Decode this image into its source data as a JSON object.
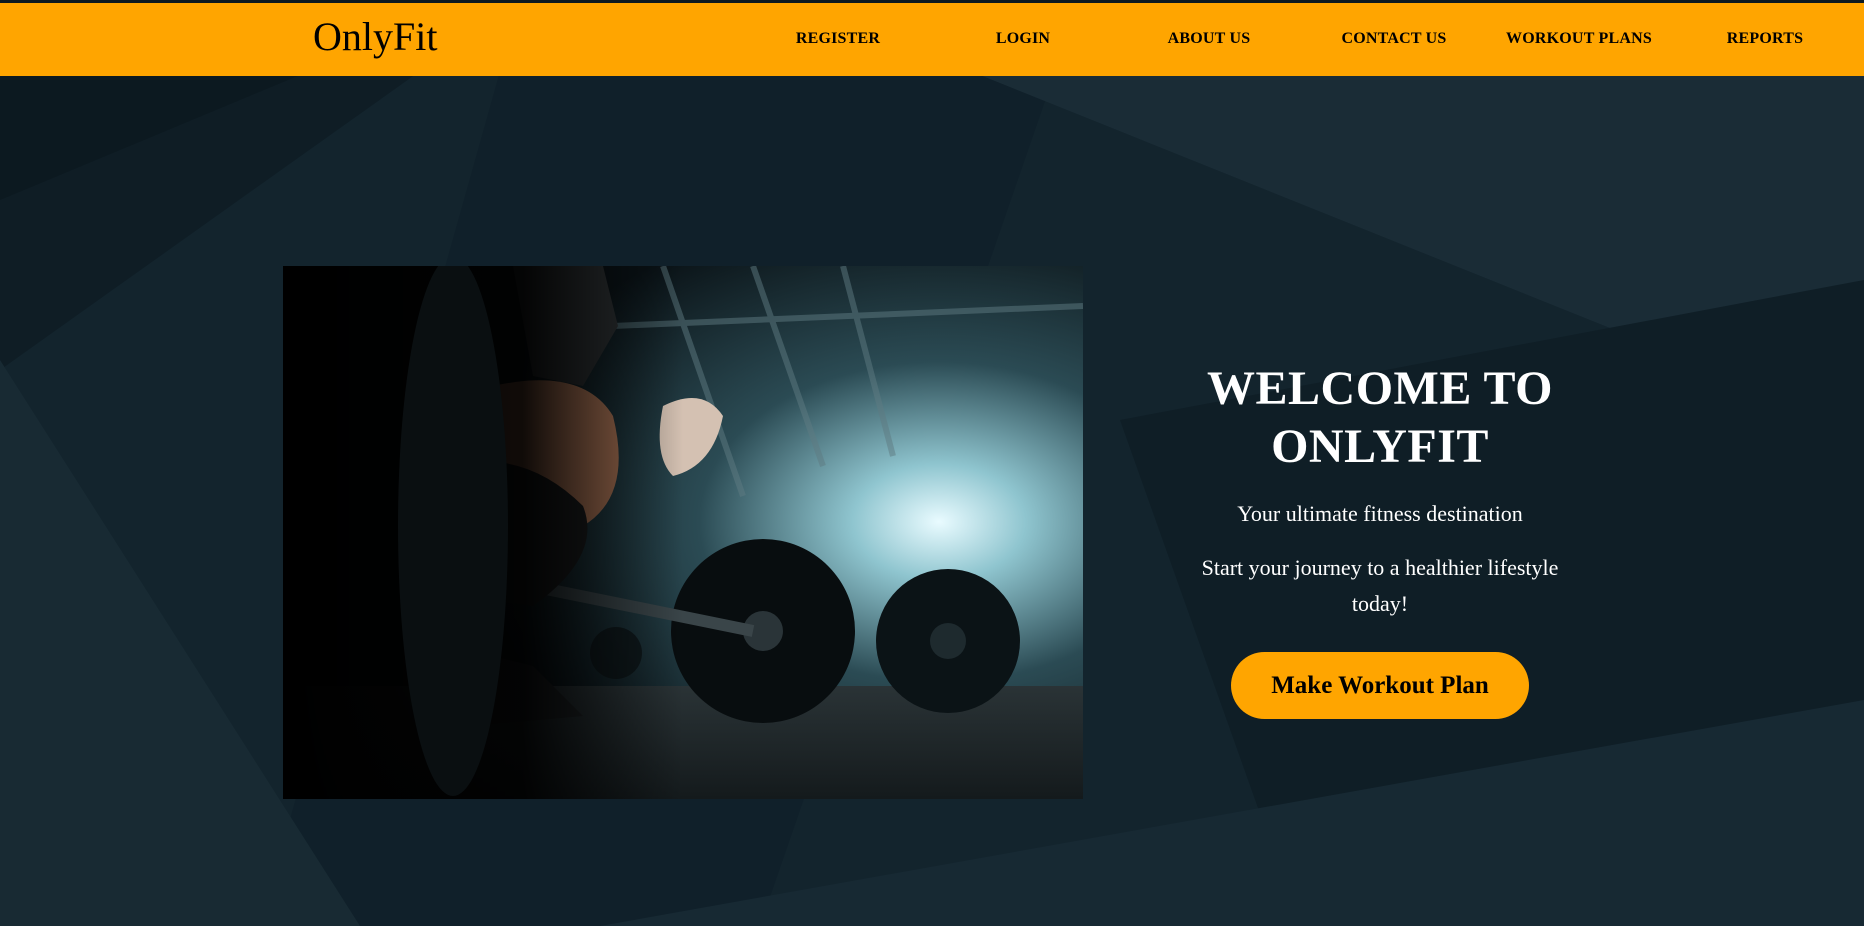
{
  "header": {
    "brand": "OnlyFit",
    "nav": [
      "REGISTER",
      "LOGIN",
      "ABOUT US",
      "CONTACT US",
      "WORKOUT PLANS",
      "REPORTS"
    ]
  },
  "hero": {
    "title_line1": "WELCOME TO",
    "title_line2": "ONLYFIT",
    "subtitle": "Your ultimate fitness destination",
    "tagline": "Start your journey to a healthier lifestyle today!",
    "cta_label": "Make Workout Plan"
  },
  "colors": {
    "accent": "#ffa500",
    "background": "#13232c",
    "text_light": "#ffffff",
    "text_dark": "#000000"
  }
}
